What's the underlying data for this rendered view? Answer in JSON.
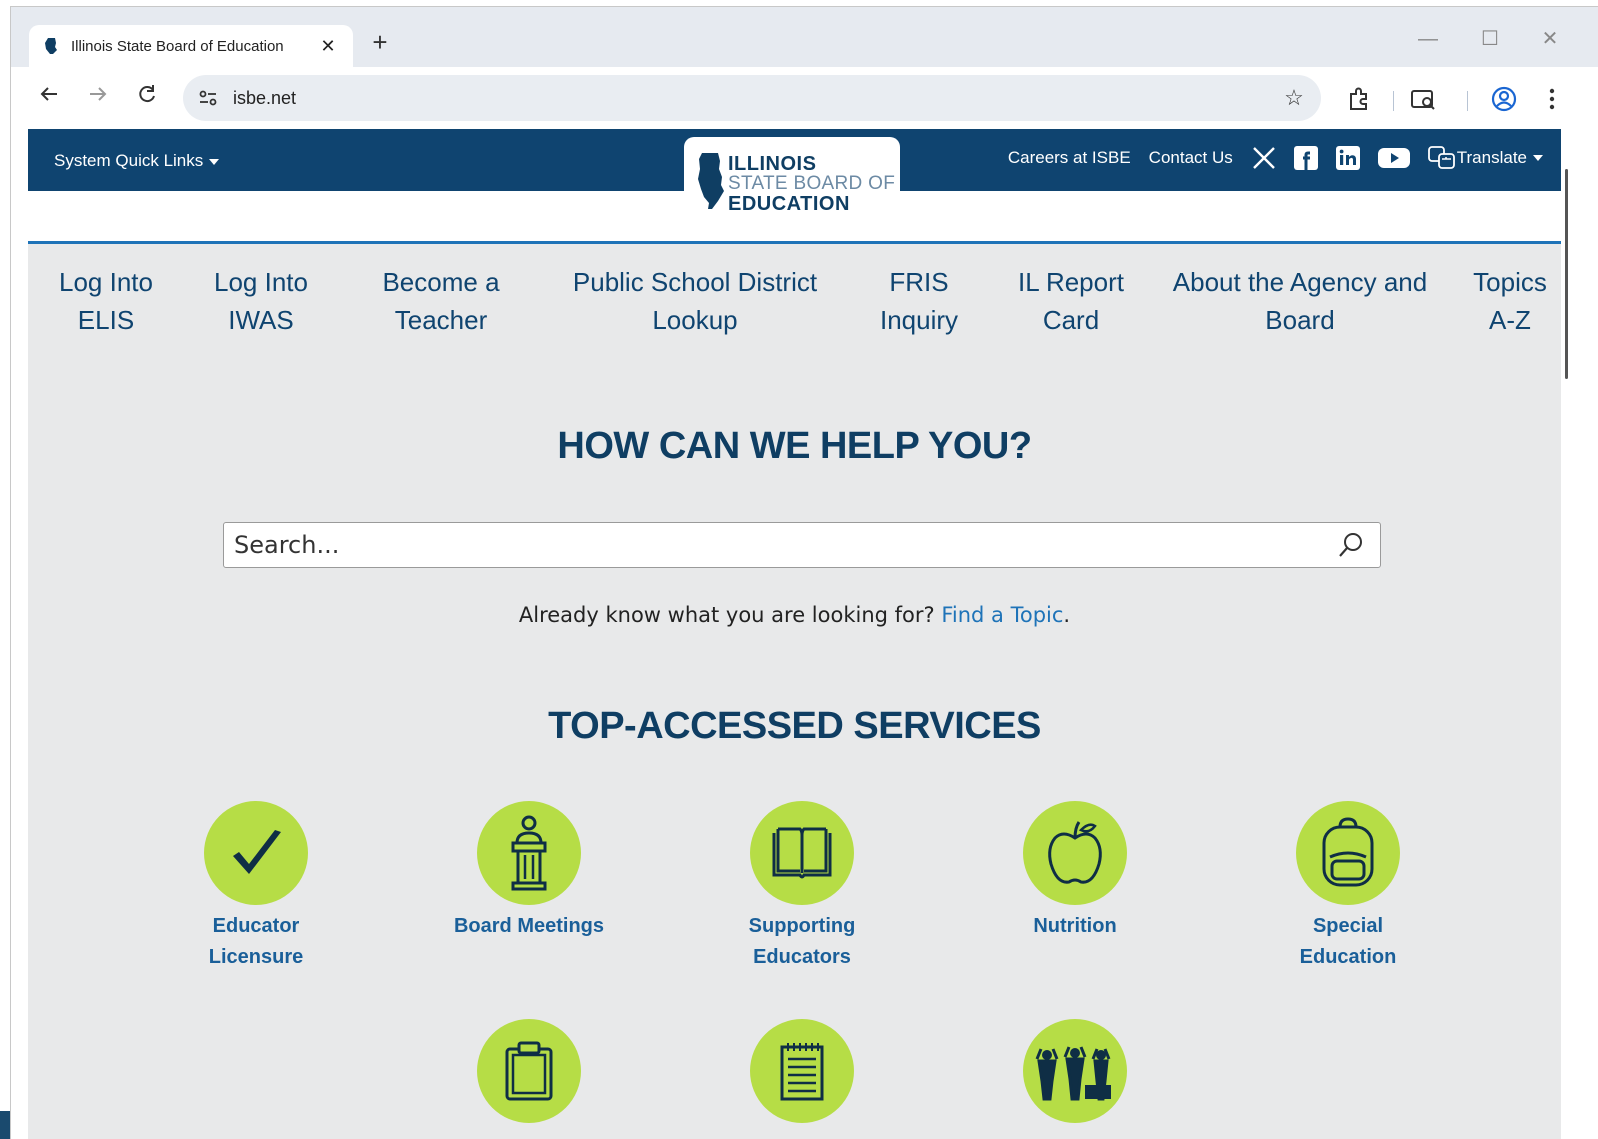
{
  "browser": {
    "tab_title": "Illinois State Board of Education",
    "tab_close": "✕",
    "new_tab": "+",
    "url": "isbe.net",
    "window_controls": {
      "minimize": "—",
      "maximize": "☐",
      "close": "✕"
    }
  },
  "header": {
    "quick_links": "System Quick Links",
    "logo": {
      "line1": "ILLINOIS",
      "line2": "STATE BOARD OF",
      "line3": "EDUCATION"
    },
    "utility_links": [
      "Careers at ISBE",
      "Contact Us"
    ],
    "social_icons": [
      "x-icon",
      "facebook-icon",
      "linkedin-icon",
      "youtube-icon"
    ],
    "translate": "Translate"
  },
  "nav": {
    "items": [
      {
        "line1": "Log Into",
        "line2": "ELIS"
      },
      {
        "line1": "Log Into",
        "line2": "IWAS"
      },
      {
        "line1": "Become a",
        "line2": "Teacher"
      },
      {
        "line1": "Public School District",
        "line2": "Lookup"
      },
      {
        "line1": "FRIS",
        "line2": "Inquiry"
      },
      {
        "line1": "IL Report",
        "line2": "Card"
      },
      {
        "line1": "About the Agency and",
        "line2": "Board"
      },
      {
        "line1": "Topics",
        "line2": "A-Z"
      }
    ]
  },
  "help": {
    "title": "HOW CAN WE HELP YOU?",
    "search_placeholder": "Search...",
    "already_text": "Already know what you are looking for?",
    "find_link": "Find a Topic",
    "find_suffix": "."
  },
  "services": {
    "title": "TOP-ACCESSED SERVICES",
    "row1": [
      {
        "line1": "Educator",
        "line2": "Licensure",
        "icon": "checkmark-icon"
      },
      {
        "line1": "Board Meetings",
        "line2": "",
        "icon": "podium-icon"
      },
      {
        "line1": "Supporting",
        "line2": "Educators",
        "icon": "book-icon"
      },
      {
        "line1": "Nutrition",
        "line2": "",
        "icon": "apple-icon"
      },
      {
        "line1": "Special",
        "line2": "Education",
        "icon": "backpack-icon"
      }
    ],
    "row2_icons": [
      "clipboard-icon",
      "notepad-icon",
      "students-icon"
    ]
  },
  "colors": {
    "brand_navy": "#0f4470",
    "accent_green": "#b6dd46",
    "link_blue": "#1e73b8"
  }
}
